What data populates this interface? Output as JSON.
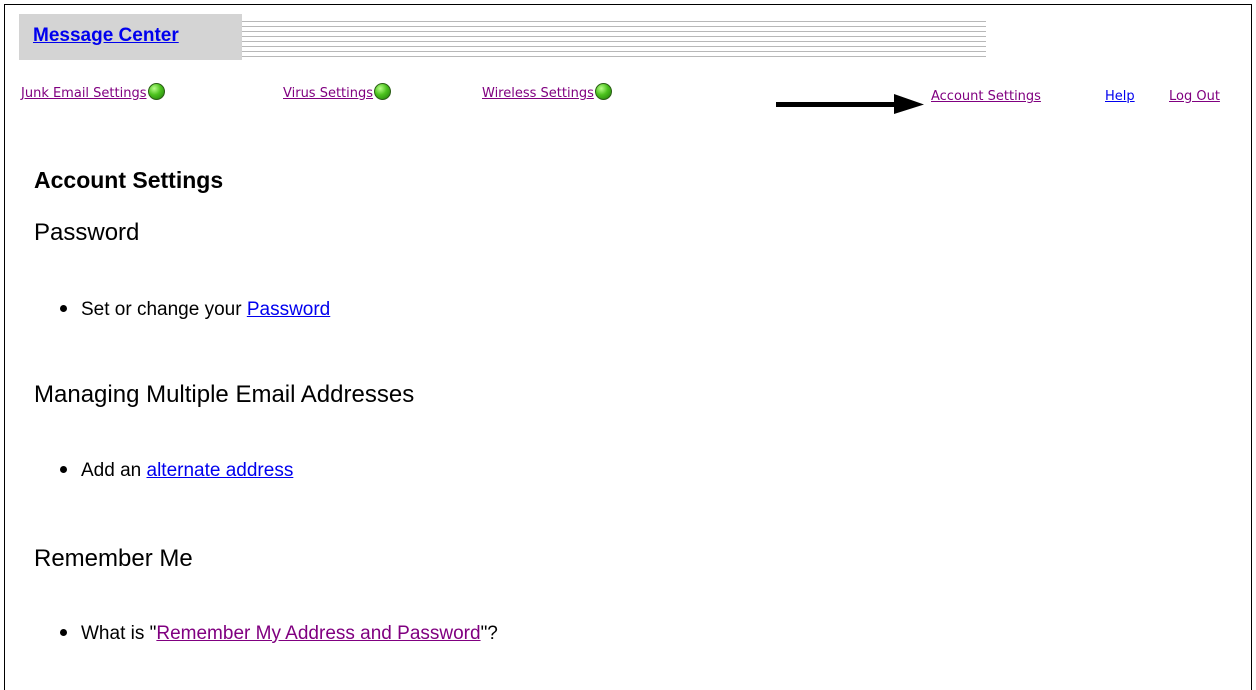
{
  "header": {
    "title_link": "Message Center"
  },
  "nav": {
    "items": [
      {
        "label": "Junk Email Settings",
        "status": "green"
      },
      {
        "label": "Virus Settings",
        "status": "green"
      },
      {
        "label": "Wireless Settings",
        "status": "green"
      }
    ],
    "right_links": {
      "account_settings": "Account Settings",
      "help": "Help",
      "log_out": "Log Out"
    }
  },
  "content": {
    "page_title": "Account Settings",
    "sections": [
      {
        "heading": "Password",
        "item_text": "Set or change your ",
        "link_text": "Password"
      },
      {
        "heading": "Managing Multiple Email Addresses",
        "item_text": "Add an ",
        "link_text": "alternate address"
      },
      {
        "heading": "Remember Me",
        "item_prefix": "What is \"",
        "link_text": "Remember My Address and Password",
        "item_suffix": "\"?"
      }
    ]
  },
  "colors": {
    "unvisited_link": "#0000ee",
    "visited_link": "#800080",
    "status_green": "#4cc21e",
    "title_box": "#d4d4d4"
  },
  "icons": [
    "status-dot-icon",
    "arrow-right-icon",
    "bullet-icon"
  ]
}
